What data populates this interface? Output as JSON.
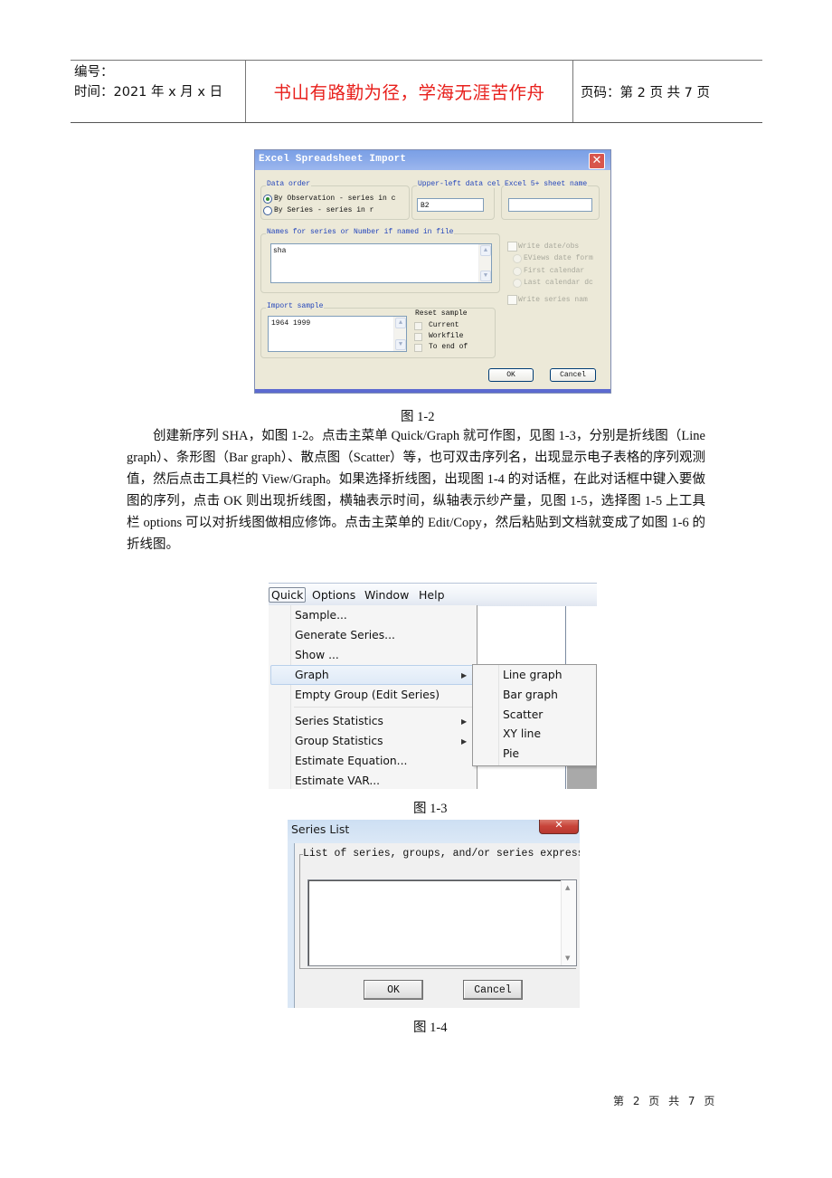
{
  "header": {
    "number_label": "编号：",
    "date_label": "时间：2021 年 x 月 x 日",
    "motto": "书山有路勤为径，学海无涯苦作舟",
    "page_label": "页码：第 2 页  共 7 页",
    "colors": {
      "motto": "#e8201c"
    }
  },
  "figure_1_2": {
    "caption": "图 1-2",
    "dialog": {
      "title": "Excel Spreadsheet Import",
      "close_icon": "close-icon",
      "data_order": {
        "label": "Data order",
        "options": [
          {
            "label": "By Observation - series in c",
            "selected": true
          },
          {
            "label": "By Series - series in r",
            "selected": false
          }
        ]
      },
      "upper_left": {
        "label": "Upper-left data cel",
        "value": "B2"
      },
      "sheet_name": {
        "label": "Excel 5+ sheet name",
        "value": ""
      },
      "names": {
        "label": "Names for series or Number if named in file",
        "value": "sha"
      },
      "write_options": {
        "write_dates": "Write date/obs",
        "eviews_format": "EViews date form",
        "first_calendar": "First calendar",
        "last_calendar": "Last calendar dc",
        "write_names": "Write series nam"
      },
      "import_sample": {
        "label": "Import sample",
        "value": "1964 1999"
      },
      "reset_sample": {
        "label": "Reset sample",
        "options": [
          "Current",
          "Workfile",
          "To end of"
        ]
      },
      "ok_label": "OK",
      "cancel_label": "Cancel"
    }
  },
  "body_text": {
    "paragraph": "创建新序列 SHA，如图 1-2。点击主菜单 Quick/Graph 就可作图，见图 1-3，分别是折线图（Line graph）、条形图（Bar graph）、散点图（Scatter）等，也可双击序列名，出现显示电子表格的序列观测值，然后点击工具栏的 View/Graph。如果选择折线图，出现图 1-4 的对话框，在此对话框中键入要做图的序列，点击 OK 则出现折线图，横轴表示时间，纵轴表示纱产量，见图 1-5，选择图 1-5 上工具栏 options 可以对折线图做相应修饰。点击主菜单的 Edit/Copy，然后粘贴到文档就变成了如图 1-6 的折线图。"
  },
  "figure_1_3": {
    "caption": "图 1-3",
    "menubar": [
      "Quick",
      "Options",
      "Window",
      "Help"
    ],
    "active_menu": "Quick",
    "menu_items": [
      {
        "label": "Sample...",
        "submenu": false
      },
      {
        "label": "Generate Series...",
        "submenu": false
      },
      {
        "label": "Show ...",
        "submenu": false
      },
      {
        "label": "Graph",
        "submenu": true,
        "highlighted": true
      },
      {
        "label": "Empty Group (Edit Series)",
        "submenu": false
      },
      {
        "label": "Series Statistics",
        "submenu": true
      },
      {
        "label": "Group Statistics",
        "submenu": true
      },
      {
        "label": "Estimate Equation...",
        "submenu": false
      },
      {
        "label": "Estimate VAR...",
        "submenu": false
      }
    ],
    "graph_submenu": [
      "Line graph",
      "Bar graph",
      "Scatter",
      "XY line",
      "Pie"
    ]
  },
  "figure_1_4": {
    "caption": "图 1-4",
    "dialog": {
      "title": "Series List",
      "close_icon": "close-icon",
      "group_label": "List of series, groups, and/or series expressions",
      "list_value": "",
      "ok_label": "OK",
      "cancel_label": "Cancel"
    }
  },
  "footer": {
    "page_text": "第 2 页 共 7 页"
  }
}
